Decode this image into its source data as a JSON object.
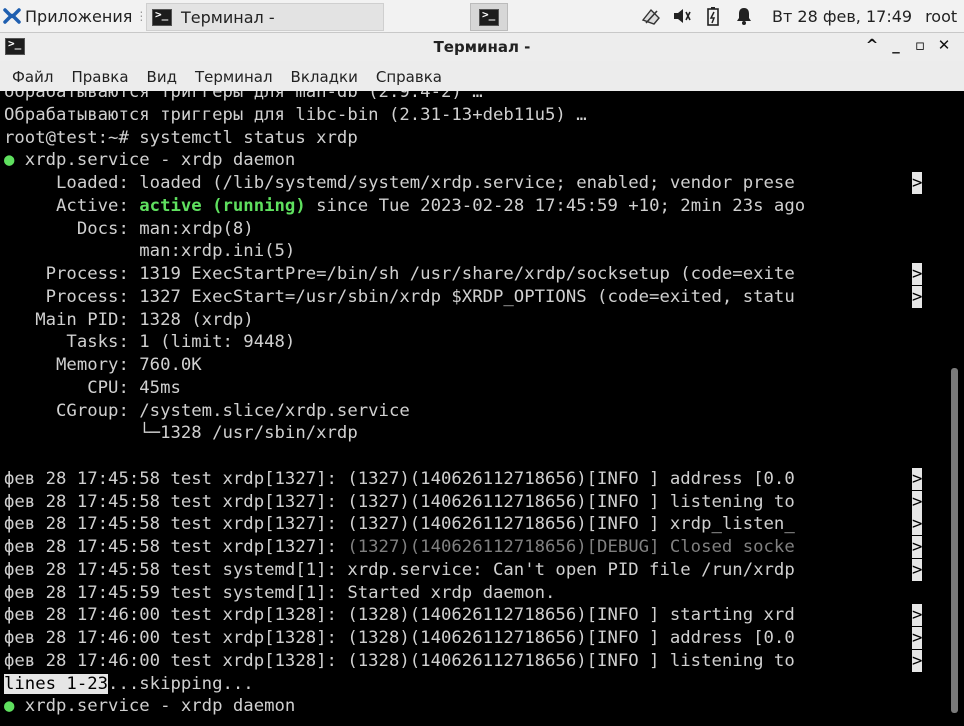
{
  "panel": {
    "apps_label": "Приложения",
    "task_title": "Терминал -",
    "clock": "Вт 28 фев, 17:49",
    "user": "root"
  },
  "window": {
    "title": "Терминал -",
    "menu": [
      "Файл",
      "Правка",
      "Вид",
      "Терминал",
      "Вкладки",
      "Справка"
    ]
  },
  "terminal": {
    "lines": [
      {
        "text": "обрабатываются триггеры для man-db (2.9.4-2) …"
      },
      {
        "text": "Обрабатываются триггеры для libc-bin (2.31-13+deb11u5) …"
      },
      {
        "text": "root@test:~# systemctl status xrdp"
      },
      {
        "bullet": "●",
        "text": " xrdp.service - xrdp daemon"
      },
      {
        "text": "     Loaded: loaded (/lib/systemd/system/xrdp.service; enabled; vendor prese",
        "more": ">"
      },
      {
        "pre": "     Active: ",
        "active": "active (running)",
        "text": " since Tue 2023-02-28 17:45:59 +10; 2min 23s ago"
      },
      {
        "text": "       Docs: man:xrdp(8)"
      },
      {
        "text": "             man:xrdp.ini(5)"
      },
      {
        "text": "    Process: 1319 ExecStartPre=/bin/sh /usr/share/xrdp/socksetup (code=exite",
        "more": ">"
      },
      {
        "text": "    Process: 1327 ExecStart=/usr/sbin/xrdp $XRDP_OPTIONS (code=exited, statu",
        "more": ">"
      },
      {
        "text": "   Main PID: 1328 (xrdp)"
      },
      {
        "text": "      Tasks: 1 (limit: 9448)"
      },
      {
        "text": "     Memory: 760.0K"
      },
      {
        "text": "        CPU: 45ms"
      },
      {
        "text": "     CGroup: /system.slice/xrdp.service"
      },
      {
        "text": "             └─1328 /usr/sbin/xrdp"
      },
      {
        "text": ""
      },
      {
        "text": "фев 28 17:45:58 test xrdp[1327]: (1327)(140626112718656)[INFO ] address [0.0",
        "more": ">"
      },
      {
        "text": "фев 28 17:45:58 test xrdp[1327]: (1327)(140626112718656)[INFO ] listening to",
        "more": ">"
      },
      {
        "text": "фев 28 17:45:58 test xrdp[1327]: (1327)(140626112718656)[INFO ] xrdp_listen_",
        "more": ">"
      },
      {
        "pre": "фев 28 17:45:58 test xrdp[1327]: ",
        "dim": "(1327)(140626112718656)[DEBUG] Closed socke",
        "more": ">"
      },
      {
        "text": "фев 28 17:45:58 test systemd[1]: xrdp.service: Can't open PID file /run/xrdp",
        "more": ">"
      },
      {
        "text": "фев 28 17:45:59 test systemd[1]: Started xrdp daemon."
      },
      {
        "text": "фев 28 17:46:00 test xrdp[1328]: (1328)(140626112718656)[INFO ] starting xrd",
        "more": ">"
      },
      {
        "text": "фев 28 17:46:00 test xrdp[1328]: (1328)(140626112718656)[INFO ] address [0.0",
        "more": ">"
      },
      {
        "text": "фев 28 17:46:00 test xrdp[1328]: (1328)(140626112718656)[INFO ] listening to",
        "more": ">"
      },
      {
        "inv": "lines 1-23",
        "text": "...skipping..."
      },
      {
        "bullet": "●",
        "text": " xrdp.service - xrdp daemon"
      }
    ]
  },
  "colors": {
    "green": "#5fe05f",
    "bg": "#000000",
    "fg": "#d0d0d0"
  }
}
